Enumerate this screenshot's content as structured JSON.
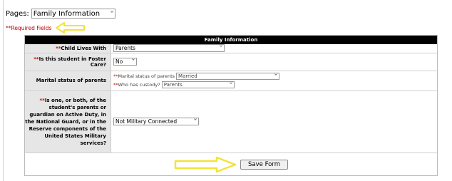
{
  "pages": {
    "label": "Pages:",
    "selected": "Family Information"
  },
  "required_note": "**Required Fields",
  "section_title": "Family Information",
  "fields": {
    "child_lives_with": {
      "star": "**",
      "label": "Child Lives With",
      "value": "Parents"
    },
    "foster_care": {
      "star": "**",
      "label": "Is this student in Foster Care?",
      "value": "No"
    },
    "marital": {
      "label": "Marital status of parents",
      "status_star": "**",
      "status_label": "Marital status of parents",
      "status_value": "Married",
      "custody_star": "**",
      "custody_label": "Who has custody?",
      "custody_value": "Parents"
    },
    "military": {
      "star": "**",
      "label": "Is one, or both, of the student's parents or guardian on Active Duty, in the National Guard, or in the Reserve components of the United States Military services?",
      "value": "Not Military Connected"
    }
  },
  "save_button": "Save Form",
  "colors": {
    "required_red": "#c00000",
    "arrow_yellow": "#f2e33a",
    "header_bg": "#000000",
    "label_bg": "#e6e6e6"
  },
  "icons": {
    "dropdown": "chevron-down-icon",
    "pointer": "arrow-annotation-icon"
  }
}
